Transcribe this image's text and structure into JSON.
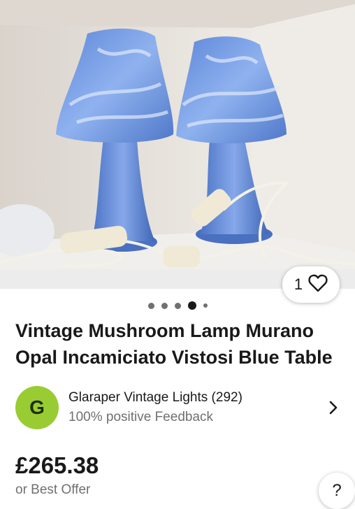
{
  "listing": {
    "watch_count": "1",
    "image_dots_total": 5,
    "image_dots_active_index": 3,
    "title": "Vintage Mushroom Lamp Murano Opal Incamiciato Vistosi Blue Table",
    "seller": {
      "avatar_letter": "G",
      "name": "Glaraper Vintage Lights (292)",
      "feedback": "100% positive Feedback"
    },
    "price": "£265.38",
    "offer_text": "or Best Offer",
    "help_label": "?"
  },
  "icons": {
    "watch": "heart-icon",
    "seller_link": "chevron-right-icon"
  },
  "colors": {
    "avatar_bg": "#99cc33",
    "text_primary": "#191919",
    "text_secondary": "#707070",
    "lamp_blue": "#6f9be8"
  }
}
